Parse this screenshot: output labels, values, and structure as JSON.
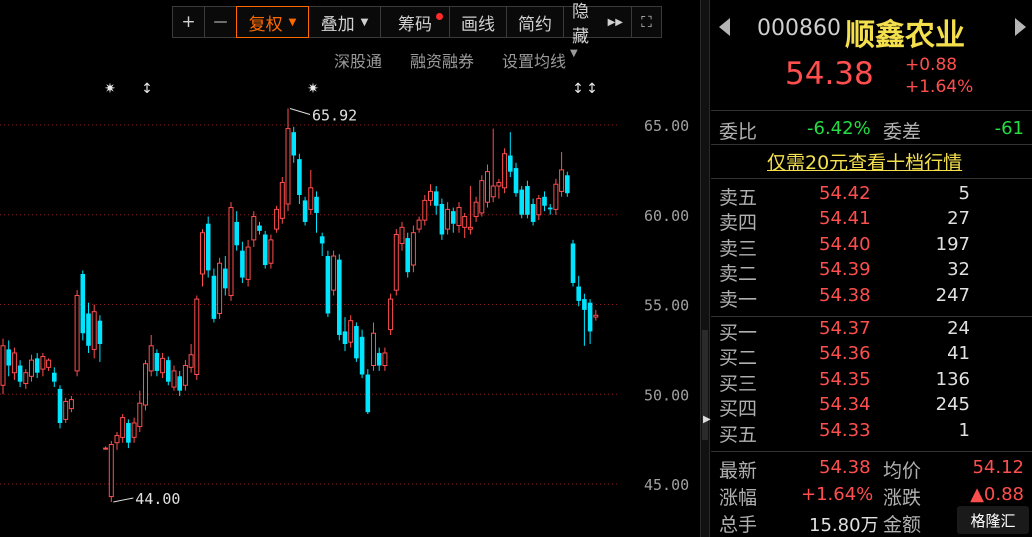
{
  "toolbar": {
    "zoom_in": "+",
    "zoom_out": "—",
    "fuquan": "复权",
    "diejia": "叠加",
    "chouma": "筹码",
    "huaxian": "画线",
    "jianyue": "简约",
    "yincang": "隐藏",
    "colors": {
      "active": "#ff6a00",
      "dot": "#ff2a2a"
    }
  },
  "subbar": {
    "shengutong": "深股通",
    "rongzi": "融资融券",
    "shezhi": "设置均线"
  },
  "chart_data": {
    "type": "candlestick",
    "y_ticks": [
      "65.00",
      "60.00",
      "55.00",
      "50.00",
      "45.00"
    ],
    "ylim": [
      43.2,
      67.2
    ],
    "annotations": {
      "high": "65.92",
      "low": "44.00"
    },
    "colors": {
      "up": "#ff4e4e",
      "down": "#00e5ff",
      "grid": "#8b1a1a"
    },
    "candles": [
      {
        "o": 50.5,
        "c": 52.7,
        "h": 53.1,
        "l": 50.0
      },
      {
        "o": 52.5,
        "c": 51.6,
        "h": 53.0,
        "l": 51.0
      },
      {
        "o": 51.2,
        "c": 52.3,
        "h": 52.6,
        "l": 50.8
      },
      {
        "o": 51.6,
        "c": 50.7,
        "h": 51.9,
        "l": 50.4
      },
      {
        "o": 50.6,
        "c": 51.2,
        "h": 51.4,
        "l": 50.3
      },
      {
        "o": 51.0,
        "c": 51.9,
        "h": 52.2,
        "l": 50.7
      },
      {
        "o": 52.0,
        "c": 51.2,
        "h": 52.3,
        "l": 50.9
      },
      {
        "o": 51.4,
        "c": 52.1,
        "h": 52.3,
        "l": 51.0
      },
      {
        "o": 51.5,
        "c": 51.9,
        "h": 52.0,
        "l": 51.3
      },
      {
        "o": 51.2,
        "c": 50.7,
        "h": 51.5,
        "l": 50.4
      },
      {
        "o": 50.3,
        "c": 48.4,
        "h": 50.5,
        "l": 48.1
      },
      {
        "o": 48.6,
        "c": 49.6,
        "h": 49.8,
        "l": 48.4
      },
      {
        "o": 49.2,
        "c": 49.7,
        "h": 49.9,
        "l": 49.0
      },
      {
        "o": 51.3,
        "c": 55.5,
        "h": 55.8,
        "l": 51.0
      },
      {
        "o": 56.7,
        "c": 53.4,
        "h": 56.9,
        "l": 53.0
      },
      {
        "o": 54.5,
        "c": 52.7,
        "h": 55.1,
        "l": 52.3
      },
      {
        "o": 52.5,
        "c": 54.6,
        "h": 55.0,
        "l": 52.0
      },
      {
        "o": 54.1,
        "c": 52.8,
        "h": 54.4,
        "l": 51.8
      },
      {
        "o": 47.0,
        "c": 47.0,
        "h": 47.1,
        "l": 46.9
      },
      {
        "o": 44.3,
        "c": 47.2,
        "h": 47.4,
        "l": 44.0
      },
      {
        "o": 47.3,
        "c": 47.7,
        "h": 47.9,
        "l": 46.9
      },
      {
        "o": 47.6,
        "c": 48.7,
        "h": 48.9,
        "l": 47.3
      },
      {
        "o": 48.4,
        "c": 47.3,
        "h": 48.6,
        "l": 47.0
      },
      {
        "o": 47.6,
        "c": 48.4,
        "h": 48.7,
        "l": 47.3
      },
      {
        "o": 48.2,
        "c": 49.5,
        "h": 50.2,
        "l": 47.9
      },
      {
        "o": 49.4,
        "c": 51.7,
        "h": 51.9,
        "l": 49.1
      },
      {
        "o": 51.3,
        "c": 52.7,
        "h": 53.3,
        "l": 51.0
      },
      {
        "o": 52.3,
        "c": 51.3,
        "h": 52.5,
        "l": 51.0
      },
      {
        "o": 51.2,
        "c": 52.0,
        "h": 52.3,
        "l": 50.9
      },
      {
        "o": 51.9,
        "c": 50.7,
        "h": 52.1,
        "l": 50.5
      },
      {
        "o": 50.4,
        "c": 51.3,
        "h": 51.6,
        "l": 50.2
      },
      {
        "o": 51.0,
        "c": 50.2,
        "h": 51.3,
        "l": 49.9
      },
      {
        "o": 50.5,
        "c": 51.6,
        "h": 51.9,
        "l": 50.2
      },
      {
        "o": 51.5,
        "c": 52.2,
        "h": 52.8,
        "l": 51.2
      },
      {
        "o": 51.1,
        "c": 55.3,
        "h": 55.5,
        "l": 50.8
      },
      {
        "o": 56.7,
        "c": 59.0,
        "h": 59.2,
        "l": 56.0
      },
      {
        "o": 59.5,
        "c": 56.9,
        "h": 59.9,
        "l": 56.5
      },
      {
        "o": 56.6,
        "c": 54.2,
        "h": 57.0,
        "l": 54.0
      },
      {
        "o": 54.5,
        "c": 57.3,
        "h": 57.6,
        "l": 54.2
      },
      {
        "o": 57.0,
        "c": 55.9,
        "h": 57.7,
        "l": 55.5
      },
      {
        "o": 55.5,
        "c": 60.4,
        "h": 60.7,
        "l": 55.2
      },
      {
        "o": 59.6,
        "c": 58.3,
        "h": 60.2,
        "l": 58.0
      },
      {
        "o": 58.0,
        "c": 56.5,
        "h": 58.5,
        "l": 56.2
      },
      {
        "o": 56.4,
        "c": 58.2,
        "h": 58.6,
        "l": 56.0
      },
      {
        "o": 58.6,
        "c": 59.9,
        "h": 60.2,
        "l": 58.2
      },
      {
        "o": 59.4,
        "c": 59.1,
        "h": 59.6,
        "l": 58.9
      },
      {
        "o": 58.9,
        "c": 57.2,
        "h": 59.1,
        "l": 57.0
      },
      {
        "o": 57.3,
        "c": 58.6,
        "h": 58.9,
        "l": 57.0
      },
      {
        "o": 59.2,
        "c": 60.3,
        "h": 60.5,
        "l": 59.0
      },
      {
        "o": 59.8,
        "c": 61.8,
        "h": 62.1,
        "l": 59.5
      },
      {
        "o": 60.6,
        "c": 64.8,
        "h": 65.92,
        "l": 60.2
      },
      {
        "o": 64.6,
        "c": 63.3,
        "h": 64.9,
        "l": 62.9
      },
      {
        "o": 63.1,
        "c": 61.1,
        "h": 63.4,
        "l": 60.6
      },
      {
        "o": 60.8,
        "c": 59.6,
        "h": 61.0,
        "l": 59.4
      },
      {
        "o": 60.3,
        "c": 61.5,
        "h": 62.5,
        "l": 60.0
      },
      {
        "o": 61.0,
        "c": 60.1,
        "h": 61.3,
        "l": 59.0
      },
      {
        "o": 58.8,
        "c": 58.4,
        "h": 59.0,
        "l": 57.7
      },
      {
        "o": 57.7,
        "c": 54.5,
        "h": 58.0,
        "l": 54.3
      },
      {
        "o": 55.8,
        "c": 57.7,
        "h": 58.0,
        "l": 55.5
      },
      {
        "o": 57.5,
        "c": 53.3,
        "h": 57.8,
        "l": 53.0
      },
      {
        "o": 53.5,
        "c": 52.8,
        "h": 54.3,
        "l": 52.4
      },
      {
        "o": 52.9,
        "c": 54.1,
        "h": 54.4,
        "l": 52.6
      },
      {
        "o": 53.8,
        "c": 52.0,
        "h": 54.0,
        "l": 51.8
      },
      {
        "o": 53.2,
        "c": 51.1,
        "h": 53.6,
        "l": 50.9
      },
      {
        "o": 51.1,
        "c": 49.0,
        "h": 51.4,
        "l": 48.9
      },
      {
        "o": 51.6,
        "c": 53.4,
        "h": 54.0,
        "l": 51.3
      },
      {
        "o": 52.3,
        "c": 51.6,
        "h": 52.6,
        "l": 51.3
      },
      {
        "o": 51.6,
        "c": 52.3,
        "h": 52.6,
        "l": 51.3
      },
      {
        "o": 53.6,
        "c": 55.3,
        "h": 55.6,
        "l": 53.3
      },
      {
        "o": 55.8,
        "c": 58.9,
        "h": 59.2,
        "l": 55.5
      },
      {
        "o": 58.4,
        "c": 59.3,
        "h": 59.6,
        "l": 58.0
      },
      {
        "o": 58.7,
        "c": 56.8,
        "h": 59.0,
        "l": 56.5
      },
      {
        "o": 57.2,
        "c": 59.0,
        "h": 59.4,
        "l": 56.8
      },
      {
        "o": 59.2,
        "c": 59.7,
        "h": 59.9,
        "l": 59.0
      },
      {
        "o": 59.7,
        "c": 60.8,
        "h": 61.1,
        "l": 59.4
      },
      {
        "o": 60.8,
        "c": 61.3,
        "h": 61.7,
        "l": 60.5
      },
      {
        "o": 61.3,
        "c": 60.5,
        "h": 61.6,
        "l": 60.0
      },
      {
        "o": 60.6,
        "c": 58.9,
        "h": 60.9,
        "l": 58.6
      },
      {
        "o": 59.2,
        "c": 60.3,
        "h": 60.7,
        "l": 58.9
      },
      {
        "o": 60.2,
        "c": 59.5,
        "h": 60.4,
        "l": 59.0
      },
      {
        "o": 59.4,
        "c": 60.4,
        "h": 60.7,
        "l": 59.0
      },
      {
        "o": 59.3,
        "c": 59.9,
        "h": 60.1,
        "l": 58.7
      },
      {
        "o": 59.2,
        "c": 59.3,
        "h": 61.6,
        "l": 58.9
      },
      {
        "o": 59.9,
        "c": 60.7,
        "h": 61.0,
        "l": 59.6
      },
      {
        "o": 60.1,
        "c": 61.9,
        "h": 62.2,
        "l": 59.9
      },
      {
        "o": 60.7,
        "c": 62.4,
        "h": 62.8,
        "l": 60.4
      },
      {
        "o": 61.0,
        "c": 61.6,
        "h": 64.8,
        "l": 60.7
      },
      {
        "o": 61.6,
        "c": 61.8,
        "h": 62.0,
        "l": 60.9
      },
      {
        "o": 61.5,
        "c": 63.4,
        "h": 63.7,
        "l": 61.2
      },
      {
        "o": 63.3,
        "c": 62.4,
        "h": 64.6,
        "l": 62.1
      },
      {
        "o": 62.6,
        "c": 61.2,
        "h": 62.9,
        "l": 61.0
      },
      {
        "o": 61.4,
        "c": 60.0,
        "h": 61.6,
        "l": 59.8
      },
      {
        "o": 61.6,
        "c": 60.0,
        "h": 61.9,
        "l": 59.8
      },
      {
        "o": 60.6,
        "c": 59.6,
        "h": 60.9,
        "l": 59.4
      },
      {
        "o": 60.0,
        "c": 60.9,
        "h": 61.1,
        "l": 59.7
      },
      {
        "o": 61.0,
        "c": 60.5,
        "h": 61.3,
        "l": 60.2
      },
      {
        "o": 60.4,
        "c": 60.3,
        "h": 60.6,
        "l": 60.0
      },
      {
        "o": 60.3,
        "c": 61.7,
        "h": 62.0,
        "l": 60.0
      },
      {
        "o": 61.3,
        "c": 62.5,
        "h": 63.5,
        "l": 61.0
      },
      {
        "o": 62.2,
        "c": 61.2,
        "h": 62.4,
        "l": 61.0
      },
      {
        "o": 58.4,
        "c": 56.2,
        "h": 58.6,
        "l": 56.0
      },
      {
        "o": 56.0,
        "c": 55.2,
        "h": 56.6,
        "l": 54.9
      },
      {
        "o": 55.3,
        "c": 54.7,
        "h": 55.6,
        "l": 52.7
      },
      {
        "o": 55.1,
        "c": 53.5,
        "h": 55.3,
        "l": 52.8
      },
      {
        "o": 54.3,
        "c": 54.4,
        "h": 54.7,
        "l": 54.1
      }
    ]
  },
  "quote": {
    "code": "000860",
    "name": "顺鑫农业",
    "price": "54.38",
    "change": "+0.88",
    "change_pct": "+1.64%",
    "weibi_label": "委比",
    "weibi_value": "-6.42%",
    "weicha_label": "委差",
    "weicha_value": "-61",
    "promo": "仅需20元查看十档行情",
    "sell": [
      {
        "label": "卖五",
        "price": "54.42",
        "vol": "5"
      },
      {
        "label": "卖四",
        "price": "54.41",
        "vol": "27"
      },
      {
        "label": "卖三",
        "price": "54.40",
        "vol": "197"
      },
      {
        "label": "卖二",
        "price": "54.39",
        "vol": "32"
      },
      {
        "label": "卖一",
        "price": "54.38",
        "vol": "247"
      }
    ],
    "buy": [
      {
        "label": "买一",
        "price": "54.37",
        "vol": "24"
      },
      {
        "label": "买二",
        "price": "54.36",
        "vol": "41"
      },
      {
        "label": "买三",
        "price": "54.35",
        "vol": "136"
      },
      {
        "label": "买四",
        "price": "54.34",
        "vol": "245"
      },
      {
        "label": "买五",
        "price": "54.33",
        "vol": "1"
      }
    ],
    "stats": {
      "latest_label": "最新",
      "latest_value": "54.38",
      "avg_label": "均价",
      "avg_value": "54.12",
      "zf_label": "涨幅",
      "zf_value": "+1.64%",
      "zd_label": "涨跌",
      "zd_value": "▲0.88",
      "zs_label": "总手",
      "zs_value": "15.80万",
      "je_label": "金额"
    },
    "logo": "格隆汇"
  }
}
